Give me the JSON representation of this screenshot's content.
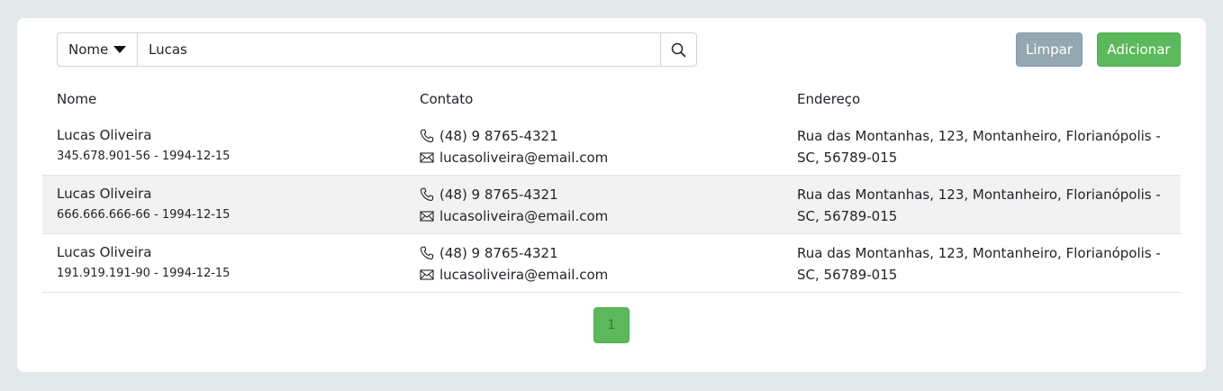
{
  "search": {
    "field_label": "Nome",
    "value": "Lucas"
  },
  "buttons": {
    "clear_label": "Limpar",
    "add_label": "Adicionar"
  },
  "table": {
    "headers": [
      "Nome",
      "Contato",
      "Endereço"
    ],
    "rows": [
      {
        "name": "Lucas Oliveira",
        "meta": "345.678.901-56 - 1994-12-15",
        "phone": "(48) 9 8765-4321",
        "email": "lucasoliveira@email.com",
        "address": "Rua das Montanhas, 123, Montanheiro, Florianópolis - SC, 56789-015"
      },
      {
        "name": "Lucas Oliveira",
        "meta": "666.666.666-66 - 1994-12-15",
        "phone": "(48) 9 8765-4321",
        "email": "lucasoliveira@email.com",
        "address": "Rua das Montanhas, 123, Montanheiro, Florianópolis - SC, 56789-015"
      },
      {
        "name": "Lucas Oliveira",
        "meta": "191.919.191-90 - 1994-12-15",
        "phone": "(48) 9 8765-4321",
        "email": "lucasoliveira@email.com",
        "address": "Rua das Montanhas, 123, Montanheiro, Florianópolis - SC, 56789-015"
      }
    ]
  },
  "pagination": {
    "current_page": "1"
  },
  "colors": {
    "accent_green": "#5cb85c",
    "muted_button": "#94a8b2",
    "page_bg": "#e3e8ea"
  }
}
